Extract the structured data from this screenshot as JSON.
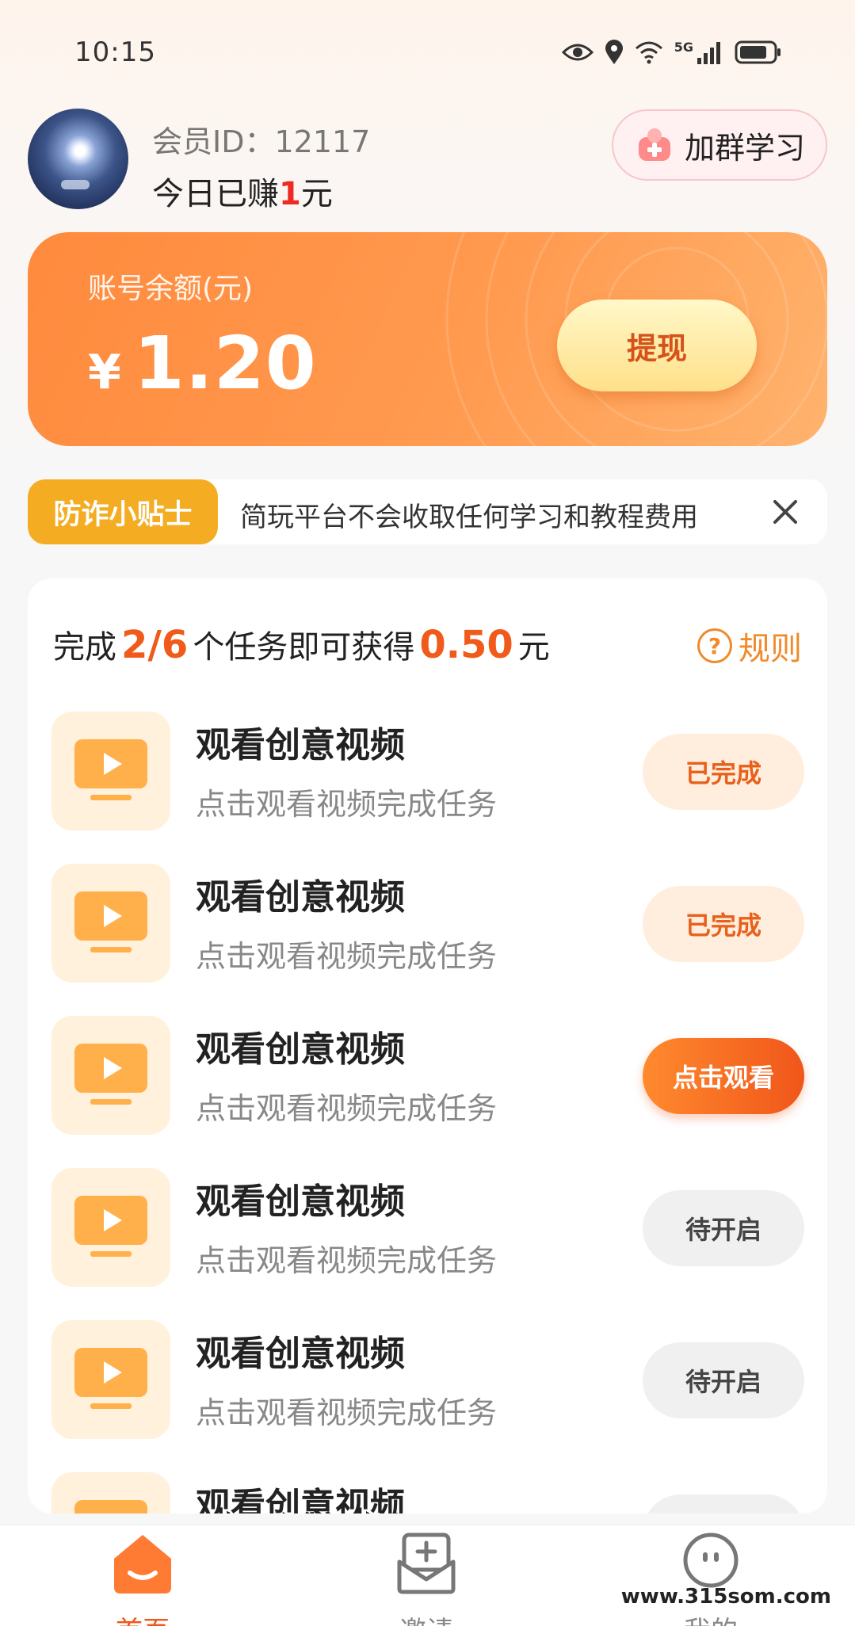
{
  "status_bar": {
    "time": "10:15",
    "network": "5G",
    "icons": [
      "eye-icon",
      "location-icon",
      "wifi-icon",
      "cellular-signal-icon",
      "battery-icon"
    ]
  },
  "header": {
    "member_id_label": "会员ID：",
    "member_id": "12117",
    "earned_prefix": "今日已赚",
    "earned_amount": "1",
    "earned_suffix": "元",
    "join_group_label": "加群学习"
  },
  "balance": {
    "label": "账号余额(元)",
    "currency": "¥",
    "amount": "1.20",
    "withdraw_label": "提现"
  },
  "tip": {
    "tag": "防诈小贴士",
    "text": "简玩平台不会收取任何学习和教程费用"
  },
  "tasks": {
    "summary_prefix": "完成",
    "progress": "2/6",
    "summary_middle": "个任务即可获得",
    "reward": "0.50",
    "summary_suffix": "元",
    "rules_label": "规则",
    "items": [
      {
        "title": "观看创意视频",
        "desc": "点击观看视频完成任务",
        "status": "已完成"
      },
      {
        "title": "观看创意视频",
        "desc": "点击观看视频完成任务",
        "status": "已完成"
      },
      {
        "title": "观看创意视频",
        "desc": "点击观看视频完成任务",
        "status": "点击观看"
      },
      {
        "title": "观看创意视频",
        "desc": "点击观看视频完成任务",
        "status": "待开启"
      },
      {
        "title": "观看创意视频",
        "desc": "点击观看视频完成任务",
        "status": "待开启"
      },
      {
        "title": "观看创意视频",
        "desc": "",
        "status": ""
      }
    ]
  },
  "bottom_nav": {
    "items": [
      {
        "label": "首页",
        "icon": "home-icon",
        "active": true
      },
      {
        "label": "邀请",
        "icon": "invite-icon",
        "active": false
      },
      {
        "label": "我的",
        "icon": "profile-icon",
        "active": false
      }
    ]
  },
  "watermark": "www.315som.com",
  "colors": {
    "accent": "#f05a1a",
    "card_orange": "#ff8a3d",
    "tip_tag": "#f4ad22",
    "done_bg": "#ffeedd",
    "wait_bg": "#f0f0f0"
  }
}
